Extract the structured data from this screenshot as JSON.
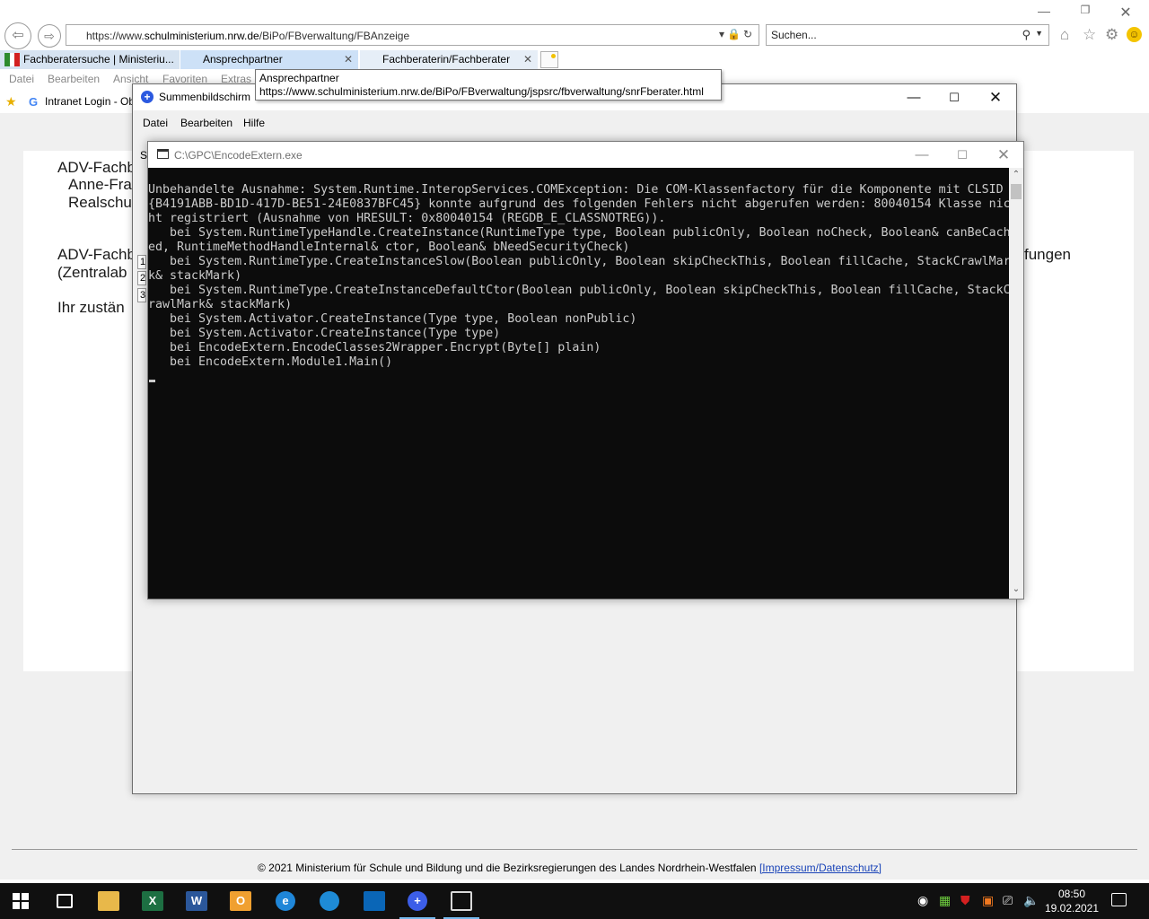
{
  "browser": {
    "address_prefix": "https://www.",
    "address_host": "schulministerium.nrw.de",
    "address_path": "/BiPo/FBverwaltung/FBAnzeige",
    "search_placeholder": "Suchen...",
    "tabs": [
      {
        "label": "Fachberatersuche | Ministeriu..."
      },
      {
        "label": "Ansprechpartner"
      },
      {
        "label": "Fachberaterin/Fachberater"
      }
    ],
    "menu": [
      "Datei",
      "Bearbeiten",
      "Ansicht",
      "Favoriten",
      "Extras"
    ],
    "favorites_link": "Intranet Login - Ob",
    "tooltip": {
      "title": "Ansprechpartner",
      "url": "https://www.schulministerium.nrw.de/BiPo/FBverwaltung/jspsrc/fbverwaltung/snrFberater.html"
    }
  },
  "page": {
    "line1": "ADV-Fachb",
    "line2": "Anne-Fra",
    "line3": "Realschu",
    "line4": "ADV-Fachb",
    "line5": "(Zentralab",
    "line6": "Ihr zustän",
    "right_fragment": "fungen",
    "footer_text": "© 2021 Ministerium für Schule und Bildung und die Bezirksregierungen des Landes Nordrhein-Westfalen ",
    "footer_link": "[Impressum/Datenschutz]"
  },
  "summen_window": {
    "title": "Summenbildschirm",
    "menu": [
      "Datei",
      "Bearbeiten",
      "Hilfe"
    ],
    "left_fragment": "S",
    "row_numbers": [
      "1",
      "2",
      "3"
    ]
  },
  "console_window": {
    "title": "C:\\GPC\\EncodeExtern.exe",
    "output": "Unbehandelte Ausnahme: System.Runtime.InteropServices.COMException: Die COM-Klassenfactory für die Komponente mit CLSID \n{B4191ABB-BD1D-417D-BE51-24E0837BFC45} konnte aufgrund des folgenden Fehlers nicht abgerufen werden: 80040154 Klasse nic\nht registriert (Ausnahme von HRESULT: 0x80040154 (REGDB_E_CLASSNOTREG)).\n   bei System.RuntimeTypeHandle.CreateInstance(RuntimeType type, Boolean publicOnly, Boolean noCheck, Boolean& canBeCach\ned, RuntimeMethodHandleInternal& ctor, Boolean& bNeedSecurityCheck)\n   bei System.RuntimeType.CreateInstanceSlow(Boolean publicOnly, Boolean skipCheckThis, Boolean fillCache, StackCrawlMar\nk& stackMark)\n   bei System.RuntimeType.CreateInstanceDefaultCtor(Boolean publicOnly, Boolean skipCheckThis, Boolean fillCache, StackC\nrawlMark& stackMark)\n   bei System.Activator.CreateInstance(Type type, Boolean nonPublic)\n   bei System.Activator.CreateInstance(Type type)\n   bei EncodeExtern.EncodeClasses2Wrapper.Encrypt(Byte[] plain)\n   bei EncodeExtern.Module1.Main()"
  },
  "taskbar": {
    "apps": [
      {
        "name": "task-view",
        "glyph": "",
        "color": "#101010"
      },
      {
        "name": "file-explorer",
        "glyph": "",
        "color": "#e8b84a"
      },
      {
        "name": "excel",
        "glyph": "X",
        "color": "#1d6f42"
      },
      {
        "name": "word",
        "glyph": "W",
        "color": "#2b579a"
      },
      {
        "name": "outlook",
        "glyph": "O",
        "color": "#f0a030"
      },
      {
        "name": "internet-explorer",
        "glyph": "e",
        "color": "#1f86d8"
      },
      {
        "name": "edge",
        "glyph": "",
        "color": "#1e8bd6"
      },
      {
        "name": "generic-app",
        "glyph": "",
        "color": "#0a66b7"
      },
      {
        "name": "summen-app",
        "glyph": "+",
        "color": "#3c5ee8"
      },
      {
        "name": "console",
        "glyph": "",
        "color": "#d9d9d9"
      }
    ],
    "clock_time": "08:50",
    "clock_date": "19.02.2021"
  }
}
